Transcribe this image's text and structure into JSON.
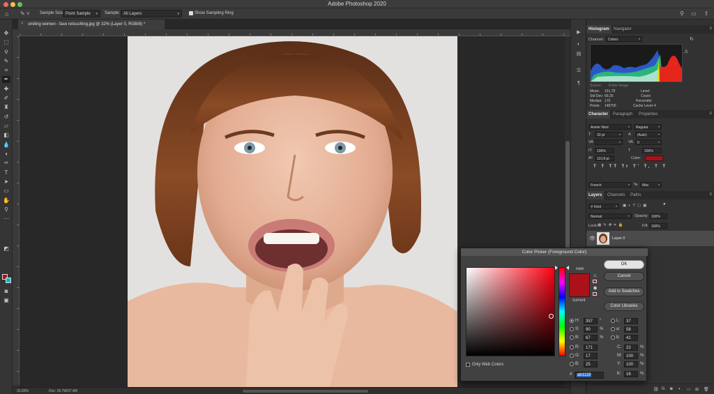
{
  "app": {
    "title": "Adobe Photoshop 2020"
  },
  "options_bar": {
    "sample_size_label": "Sample Size:",
    "sample_size_value": "Point Sample",
    "sample_label": "Sample:",
    "sample_value": "All Layers",
    "show_sampling_ring_label": "Show Sampling Ring",
    "show_sampling_ring_checked": true
  },
  "document": {
    "tab_title": "smiling women - face retouching.jpg @ 32% (Layer 0, RGB/8) *",
    "zoom": "32,83%",
    "doc_size": "Doc: 26,7M/37,4M"
  },
  "colors": {
    "foreground": "#ab1119",
    "background": "#14b7c9",
    "accent_selection": "#2f66b7"
  },
  "histogram_panel": {
    "tabs": [
      "Histogram",
      "Navigator"
    ],
    "active_tab": "Histogram",
    "channel_label": "Channel:",
    "channel_value": "Colors",
    "source_label": "Source:",
    "source_value": "Entire Image",
    "stats_left": [
      {
        "label": "Mean:",
        "value": "151,78"
      },
      {
        "label": "Std Dev:",
        "value": "69,25"
      },
      {
        "label": "Median:",
        "value": "170"
      },
      {
        "label": "Pixels:",
        "value": "148756"
      }
    ],
    "stats_right": [
      {
        "label": "Level:",
        "value": ""
      },
      {
        "label": "Count:",
        "value": ""
      },
      {
        "label": "Percentile:",
        "value": ""
      },
      {
        "label": "Cache Level:",
        "value": "4"
      }
    ]
  },
  "character_panel": {
    "tabs": [
      "Character",
      "Paragraph",
      "Properties"
    ],
    "active_tab": "Character",
    "font_family": "Avenir Next",
    "font_style": "Regular",
    "font_size": "33 pt",
    "leading": "(Auto)",
    "kerning": "",
    "tracking": "0",
    "vertical_scale": "100%",
    "horizontal_scale": "100%",
    "baseline_shift": "110,8 pt",
    "color_label": "Color:",
    "type_styles": "T T TT Tr T' T, T T",
    "language": "French",
    "antialias": "Mac"
  },
  "layers_panel": {
    "tabs": [
      "Layers",
      "Channels",
      "Paths"
    ],
    "active_tab": "Layers",
    "filter_kind": "Kind",
    "blend_mode": "Normal",
    "opacity_label": "Opacity:",
    "opacity_value": "100%",
    "lock_label": "Lock:",
    "fill_label": "Fill:",
    "fill_value": "100%",
    "layers": [
      {
        "name": "Layer 0",
        "visible": true
      }
    ]
  },
  "color_picker": {
    "title": "Color Picker (Foreground Color)",
    "new_label": "new",
    "current_label": "current",
    "buttons": {
      "ok": "OK",
      "cancel": "Cancel",
      "add_to_swatches": "Add to Swatches",
      "color_libraries": "Color Libraries"
    },
    "only_web_colors_label": "Only Web Colors",
    "only_web_colors_checked": false,
    "selected_mode": "H",
    "hsb": [
      {
        "label": "H:",
        "value": "357",
        "unit": "°"
      },
      {
        "label": "S:",
        "value": "90",
        "unit": "%"
      },
      {
        "label": "B:",
        "value": "67",
        "unit": "%"
      }
    ],
    "rgb": [
      {
        "label": "R:",
        "value": "171"
      },
      {
        "label": "G:",
        "value": "17"
      },
      {
        "label": "B:",
        "value": "25"
      }
    ],
    "lab": [
      {
        "label": "L:",
        "value": "37"
      },
      {
        "label": "a:",
        "value": "58"
      },
      {
        "label": "b:",
        "value": "41"
      }
    ],
    "cmyk": [
      {
        "label": "C:",
        "value": "22",
        "unit": "%"
      },
      {
        "label": "M:",
        "value": "100",
        "unit": "%"
      },
      {
        "label": "Y:",
        "value": "100",
        "unit": "%"
      },
      {
        "label": "K:",
        "value": "16",
        "unit": "%"
      }
    ],
    "hex_label": "#",
    "hex_value": "ab1119"
  }
}
